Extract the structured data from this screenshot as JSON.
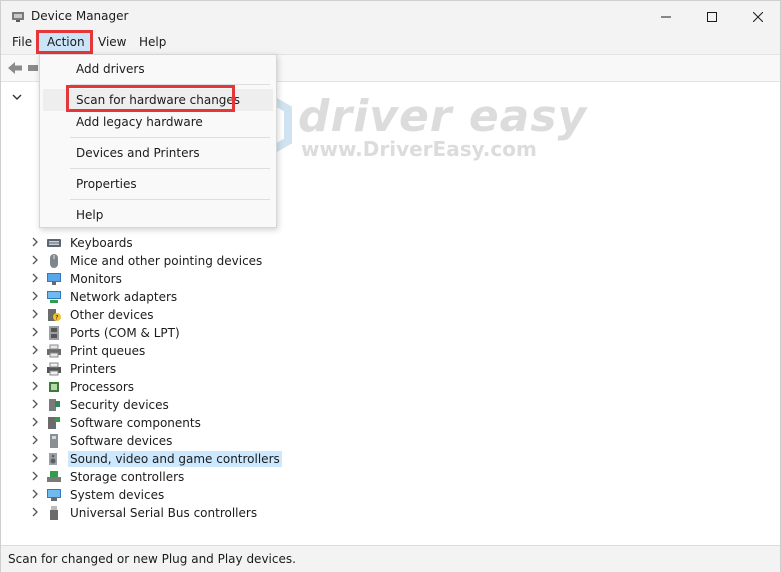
{
  "window": {
    "title": "Device Manager"
  },
  "menubar": {
    "file": "File",
    "action": "Action",
    "view": "View",
    "help": "Help"
  },
  "action_menu": {
    "items": [
      {
        "label": "Add drivers"
      },
      {
        "label": "Scan for hardware changes"
      },
      {
        "label": "Add legacy hardware"
      },
      {
        "label": "Devices and Printers"
      },
      {
        "label": "Properties"
      },
      {
        "label": "Help"
      }
    ]
  },
  "tree": {
    "items": [
      {
        "label": "Keyboards",
        "icon": "keyboard-icon"
      },
      {
        "label": "Mice and other pointing devices",
        "icon": "mouse-icon"
      },
      {
        "label": "Monitors",
        "icon": "monitor-icon"
      },
      {
        "label": "Network adapters",
        "icon": "network-icon"
      },
      {
        "label": "Other devices",
        "icon": "unknown-device-icon"
      },
      {
        "label": "Ports (COM & LPT)",
        "icon": "port-icon"
      },
      {
        "label": "Print queues",
        "icon": "print-queue-icon"
      },
      {
        "label": "Printers",
        "icon": "printer-icon"
      },
      {
        "label": "Processors",
        "icon": "processor-icon"
      },
      {
        "label": "Security devices",
        "icon": "security-icon"
      },
      {
        "label": "Software components",
        "icon": "software-component-icon"
      },
      {
        "label": "Software devices",
        "icon": "software-device-icon"
      },
      {
        "label": "Sound, video and game controllers",
        "icon": "speaker-icon",
        "selected": true
      },
      {
        "label": "Storage controllers",
        "icon": "storage-icon"
      },
      {
        "label": "System devices",
        "icon": "system-icon"
      },
      {
        "label": "Universal Serial Bus controllers",
        "icon": "usb-icon"
      }
    ]
  },
  "watermark": {
    "brand": "driver easy",
    "url": "www.DriverEasy.com"
  },
  "status": {
    "text": "Scan for changed or new Plug and Play devices."
  },
  "colors": {
    "highlight_red": "#e5363a",
    "selection_blue": "#cce8ff"
  }
}
